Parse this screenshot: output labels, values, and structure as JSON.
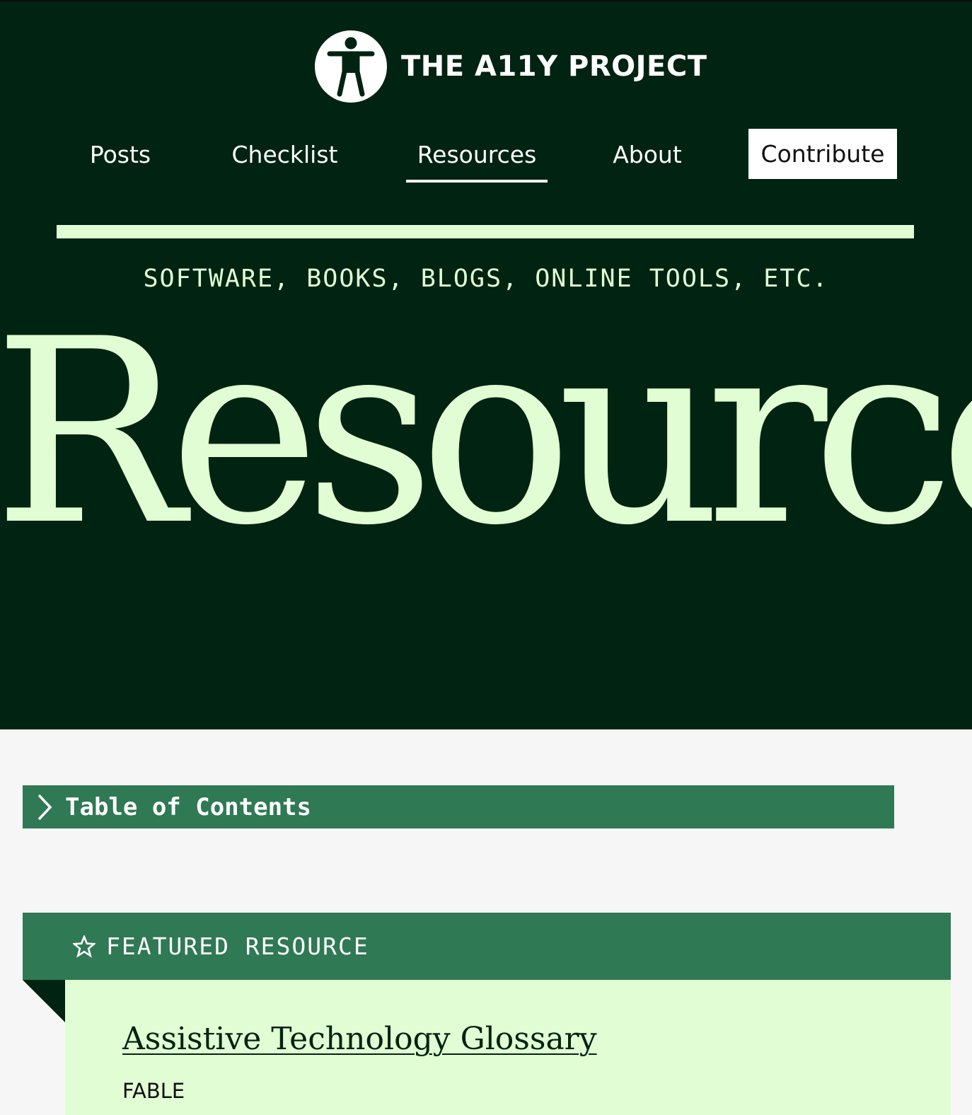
{
  "header": {
    "brand_name": "THE A11Y PROJECT",
    "logo_icon": "accessibility-person-icon"
  },
  "nav": {
    "items": [
      {
        "label": "Posts"
      },
      {
        "label": "Checklist"
      },
      {
        "label": "Resources",
        "active": true
      },
      {
        "label": "About"
      }
    ],
    "contribute_label": "Contribute"
  },
  "hero": {
    "tagline": "SOFTWARE, BOOKS, BLOGS, ONLINE TOOLS, ETC.",
    "title": "Resources"
  },
  "toc": {
    "label": "Table of Contents",
    "icon": "chevron-right-icon"
  },
  "featured": {
    "band_label": "FEATURED RESOURCE",
    "band_icon": "star-icon",
    "title": "Assistive Technology Glossary",
    "author": "FABLE"
  },
  "colors": {
    "hero_bg": "#012312",
    "accent_light": "#e1fdd3",
    "accent_green": "#2f7954",
    "page_bg": "#f6f6f6"
  }
}
